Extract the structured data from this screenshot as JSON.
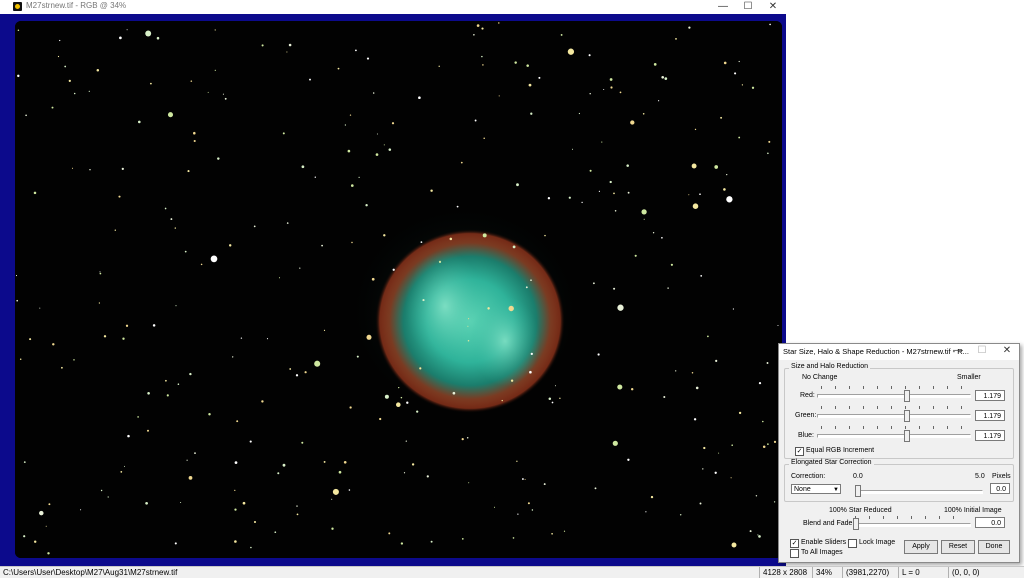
{
  "window": {
    "title": "M27strnew.tif - RGB @ 34%",
    "icons": {
      "app": "app-icon",
      "minimize": "minimize-icon",
      "maximize": "maximize-icon",
      "close": "close-icon"
    },
    "glyphs": {
      "minimize": "—",
      "maximize": "☐",
      "close": "✕"
    }
  },
  "image": {
    "description_icon": "nebula-image",
    "frame_color": "#0c0a8c",
    "background": "#020202"
  },
  "dialog": {
    "title": "Star Size, Halo & Shape Reduction - M27strnew.tif - R...",
    "glyphs": {
      "minimize": "—",
      "maximize": "☐",
      "close": "✕"
    },
    "size_halo": {
      "group_label": "Size and Halo Reduction",
      "left_caption": "No Change",
      "right_caption": "Smaller",
      "red_label": "Red:",
      "red_value": "1.179",
      "green_label": "Green:",
      "green_value": "1.179",
      "blue_label": "Blue:",
      "blue_value": "1.179",
      "slider_fraction": 0.59,
      "equal_rgb_label": "Equal RGB Increment",
      "equal_rgb_checked": "✓"
    },
    "elongated": {
      "group_label": "Elongated Star Correction",
      "correction_label": "Correction:",
      "min_caption": "0.0",
      "max_caption": "5.0",
      "unit_caption": "Pixels",
      "select_value": "None",
      "value": "0.0",
      "slider_fraction": 0.0
    },
    "blend": {
      "left_caption": "100% Star Reduced",
      "right_caption": "100% Initial Image",
      "label": "Blend and Fade:",
      "value": "0.0",
      "slider_fraction": 0.0
    },
    "enable_sliders_label": "Enable Sliders",
    "enable_sliders_checked": "✓",
    "to_all_images_label": "To All Images",
    "lock_image_label": "Lock Image",
    "apply_label": "Apply",
    "reset_label": "Reset",
    "done_label": "Done"
  },
  "statusbar": {
    "path": "C:\\Users\\User\\Desktop\\M27\\Aug31\\M27strnew.tif",
    "dimensions": "4128 x 2808",
    "zoom": "34%",
    "coords": "(3981,2270)",
    "luminance": "L = 0",
    "rgb": "(0, 0, 0)"
  }
}
